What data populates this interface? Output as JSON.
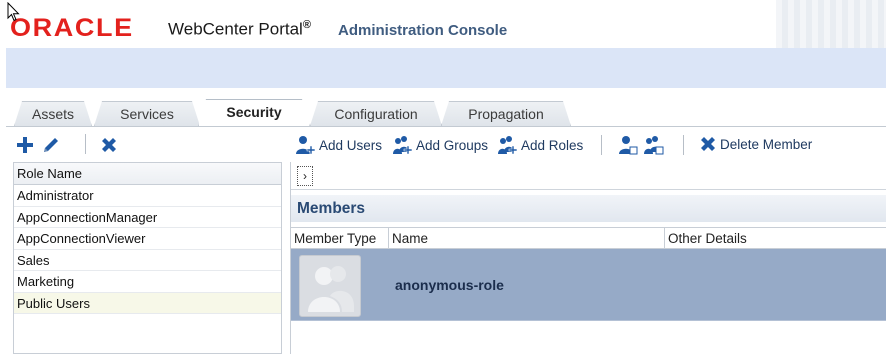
{
  "header": {
    "logo_text": "ORACLE",
    "product_name": "WebCenter Portal",
    "registered_mark": "®",
    "console_title": "Administration Console"
  },
  "tabs": [
    {
      "label": "Assets",
      "active": false
    },
    {
      "label": "Services",
      "active": false
    },
    {
      "label": "Security",
      "active": true
    },
    {
      "label": "Configuration",
      "active": false
    },
    {
      "label": "Propagation",
      "active": false
    }
  ],
  "left_toolbar": {
    "icons": [
      "add-icon",
      "edit-icon",
      "delete-icon"
    ]
  },
  "roles": {
    "column_header": "Role Name",
    "items": [
      "Administrator",
      "AppConnectionManager",
      "AppConnectionViewer",
      "Sales",
      "Marketing",
      "Public Users"
    ],
    "selected_index": 5
  },
  "right_toolbar": {
    "add_users": "Add Users",
    "add_groups": "Add Groups",
    "add_roles": "Add Roles",
    "delete_member": "Delete Member"
  },
  "members": {
    "expand_glyph": "›",
    "title": "Members",
    "columns": [
      "Member Type",
      "Name",
      "Other Details"
    ],
    "rows": [
      {
        "member_type_icon": "group-avatar-icon",
        "name": "anonymous-role",
        "other_details": ""
      }
    ]
  },
  "colors": {
    "oracle_red": "#e3211d",
    "title_blue": "#3f5c80",
    "band_blue": "#dbe5f7",
    "selected_row": "#96aac7",
    "icon_blue": "#1f5aa6"
  }
}
